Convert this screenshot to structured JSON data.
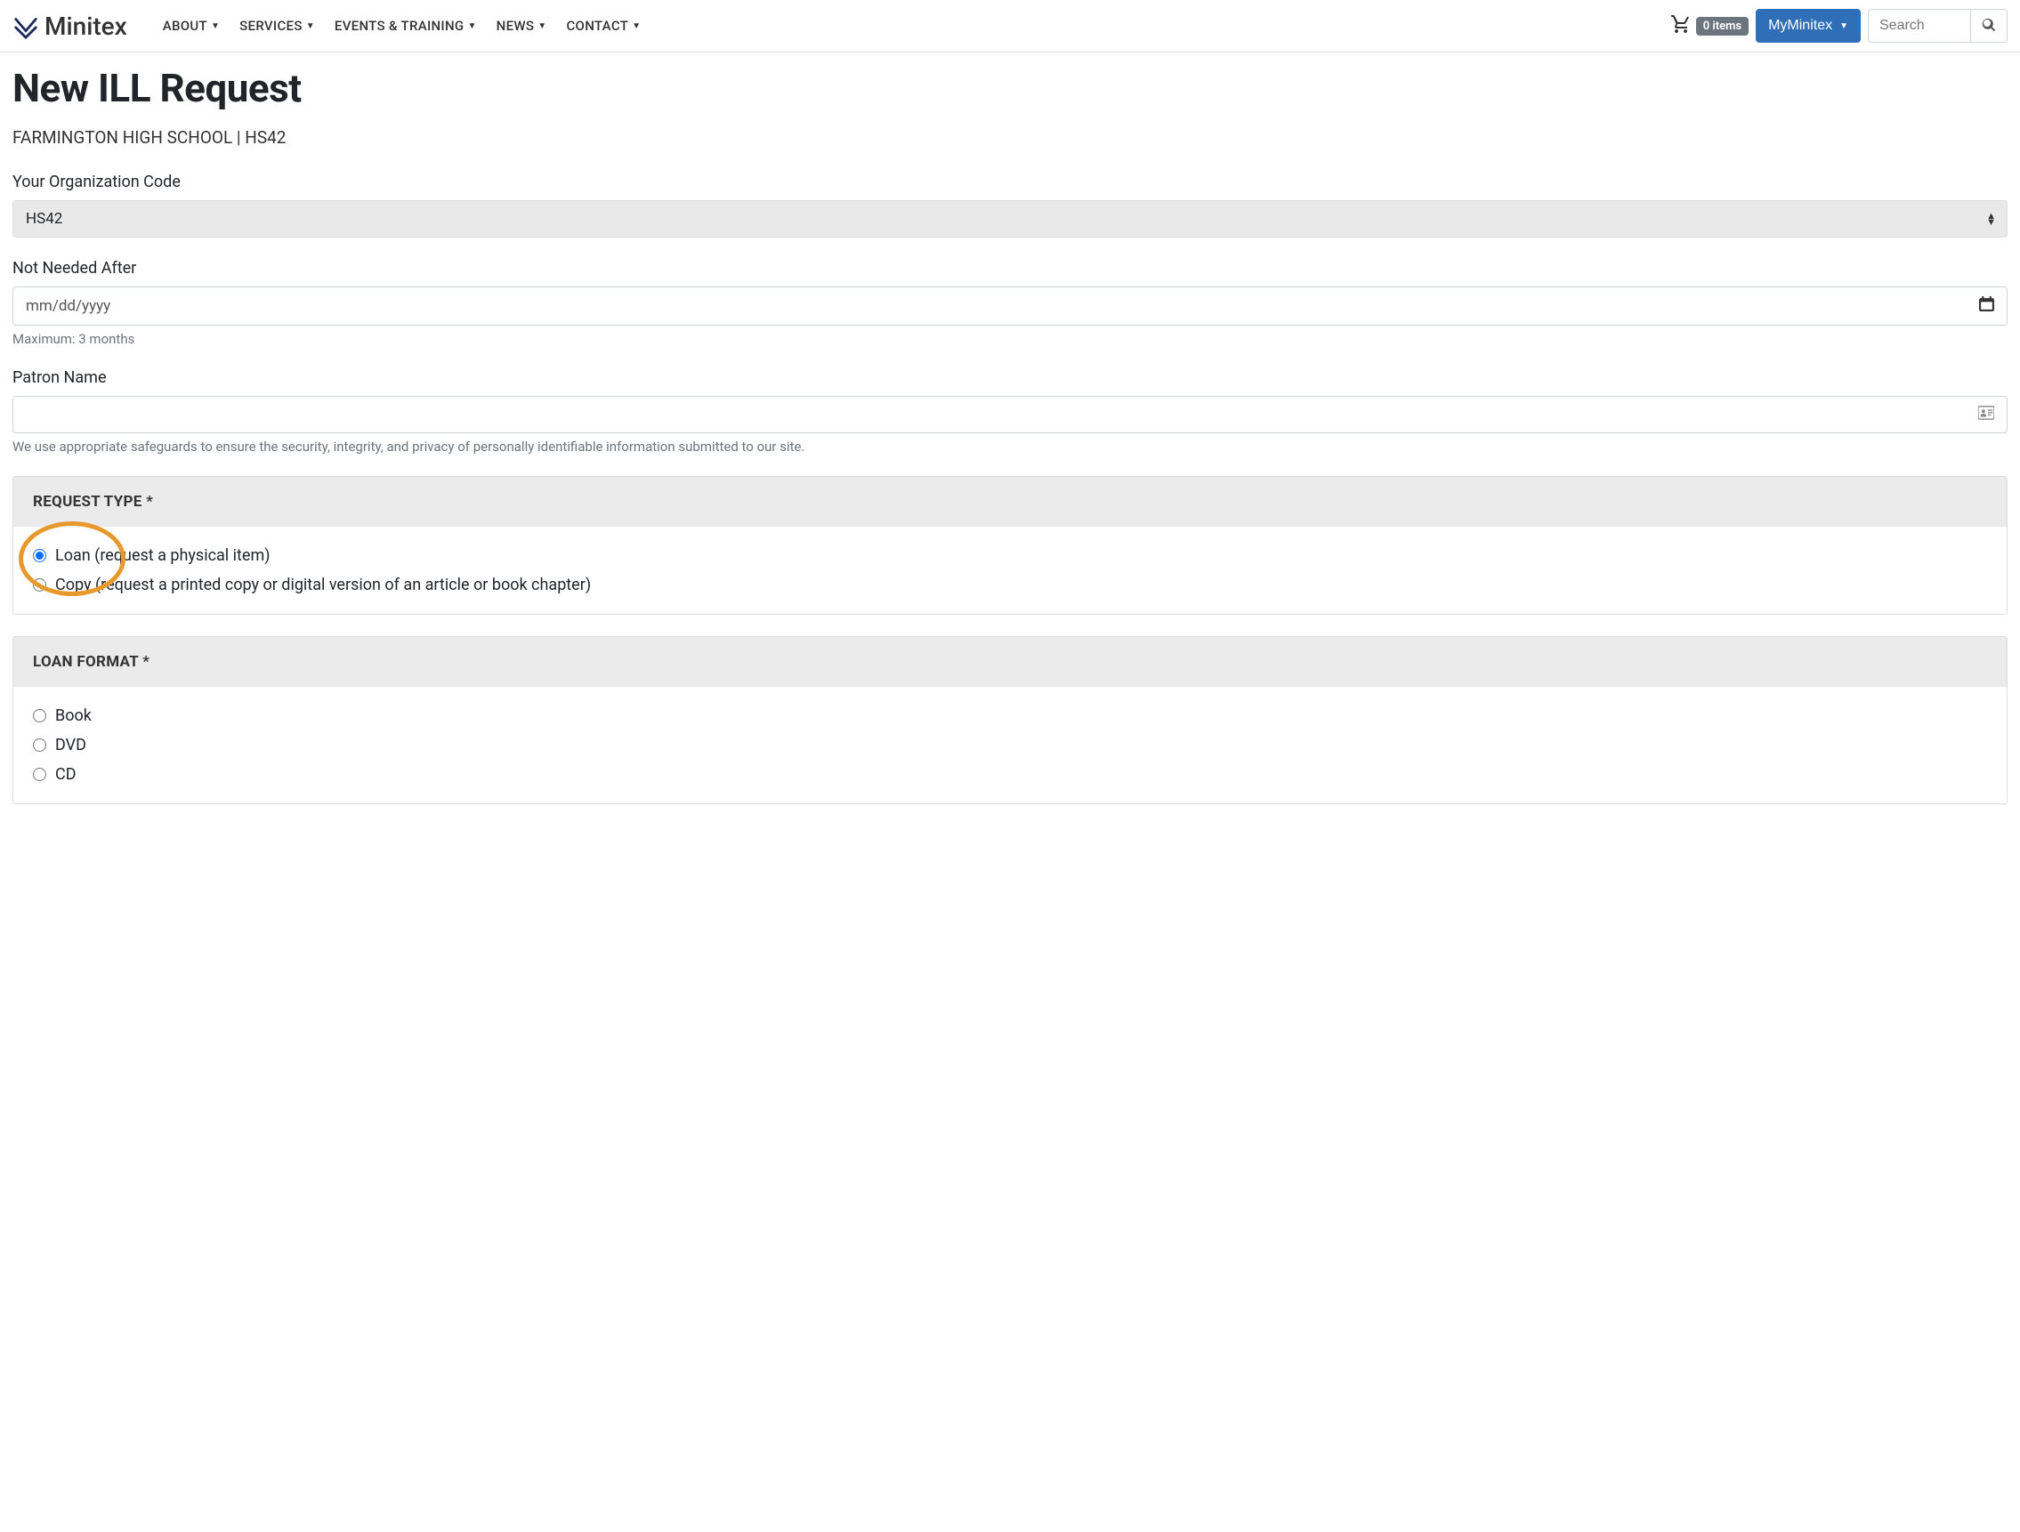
{
  "header": {
    "logo_text": "Minitex",
    "nav": [
      {
        "label": "ABOUT"
      },
      {
        "label": "SERVICES"
      },
      {
        "label": "EVENTS & TRAINING"
      },
      {
        "label": "NEWS"
      },
      {
        "label": "CONTACT"
      }
    ],
    "cart_badge": "0 items",
    "myminitex_label": "MyMinitex",
    "search_placeholder": "Search"
  },
  "page": {
    "title": "New ILL Request",
    "subtitle": "FARMINGTON HIGH SCHOOL | HS42"
  },
  "form": {
    "org_code_label": "Your Organization Code",
    "org_code_value": "HS42",
    "not_needed_label": "Not Needed After",
    "date_placeholder": "mm/dd/yyyy",
    "date_helper": "Maximum: 3 months",
    "patron_label": "Patron Name",
    "patron_helper": "We use appropriate safeguards to ensure the security, integrity, and privacy of personally identifiable information submitted to our site.",
    "request_type_header": "REQUEST TYPE *",
    "request_type_options": [
      {
        "label": "Loan (request a physical item)",
        "checked": true
      },
      {
        "label": "Copy (request a printed copy or digital version of an article or book chapter)",
        "checked": false
      }
    ],
    "loan_format_header": "LOAN FORMAT *",
    "loan_format_options": [
      {
        "label": "Book"
      },
      {
        "label": "DVD"
      },
      {
        "label": "CD"
      }
    ]
  }
}
